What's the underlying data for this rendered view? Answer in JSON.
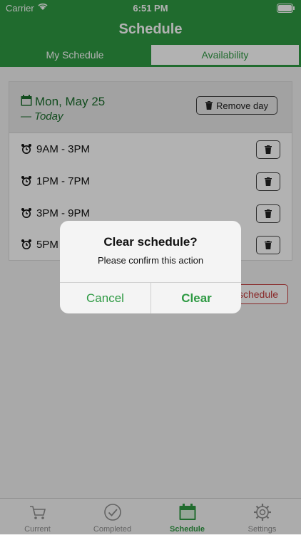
{
  "status_bar": {
    "carrier": "Carrier",
    "time": "6:51 PM"
  },
  "nav": {
    "title": "Schedule"
  },
  "segments": {
    "left": "My Schedule",
    "right": "Availability"
  },
  "card": {
    "day": "Mon, May 25",
    "today": "— Today",
    "remove_day_label": "Remove day",
    "slots": [
      {
        "label": "9AM - 3PM"
      },
      {
        "label": "1PM - 7PM"
      },
      {
        "label": "3PM - 9PM"
      },
      {
        "label": "5PM - 11PM"
      }
    ]
  },
  "clear_schedule_label": "schedule",
  "alert": {
    "title": "Clear schedule?",
    "message": "Please confirm this action",
    "cancel": "Cancel",
    "clear": "Clear"
  },
  "tabbar": {
    "tabs": [
      {
        "label": "Current",
        "icon": "cart-icon"
      },
      {
        "label": "Completed",
        "icon": "checkmark-circle-icon"
      },
      {
        "label": "Schedule",
        "icon": "calendar-icon"
      },
      {
        "label": "Settings",
        "icon": "gear-icon"
      }
    ]
  },
  "colors": {
    "brand_green": "#2e9a43",
    "destructive_red": "#c43c3c"
  }
}
